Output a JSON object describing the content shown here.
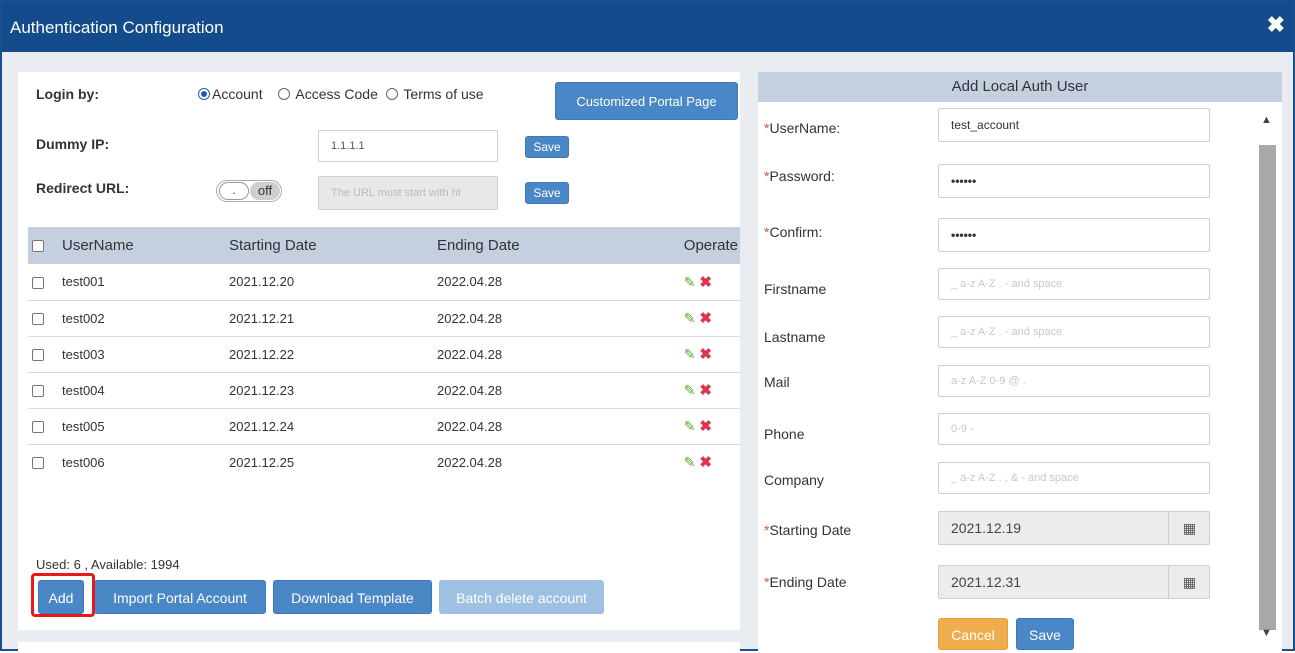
{
  "dialog": {
    "title": "Authentication Configuration",
    "close_glyph": "✖"
  },
  "left": {
    "login_by_label": "Login by:",
    "login_options": [
      {
        "label": "Account",
        "selected": true
      },
      {
        "label": "Access Code",
        "selected": false
      },
      {
        "label": "Terms of use",
        "selected": false
      }
    ],
    "customized_portal_btn": "Customized Portal Page",
    "dummy_ip_label": "Dummy IP:",
    "dummy_ip_value": "1.1.1.1",
    "save_label": "Save",
    "redirect_url_label": "Redirect URL:",
    "redirect_toggle_knob": ".",
    "redirect_toggle_state": "off",
    "redirect_url_placeholder": "The URL must start with ht",
    "table": {
      "headers": [
        "UserName",
        "Starting Date",
        "Ending Date",
        "Operate"
      ],
      "rows": [
        {
          "username": "test001",
          "start": "2021.12.20",
          "end": "2022.04.28"
        },
        {
          "username": "test002",
          "start": "2021.12.21",
          "end": "2022.04.28"
        },
        {
          "username": "test003",
          "start": "2021.12.22",
          "end": "2022.04.28"
        },
        {
          "username": "test004",
          "start": "2021.12.23",
          "end": "2022.04.28"
        },
        {
          "username": "test005",
          "start": "2021.12.24",
          "end": "2022.04.28"
        },
        {
          "username": "test006",
          "start": "2021.12.25",
          "end": "2022.04.28"
        }
      ]
    },
    "usage_text": "Used: 6 , Available: 1994",
    "buttons": {
      "add": "Add",
      "import": "Import Portal Account",
      "download": "Download Template",
      "batch_delete": "Batch delete account"
    }
  },
  "right": {
    "header": "Add Local Auth User",
    "fields": {
      "username": {
        "label": "UserName:",
        "required": true,
        "value": "test_account"
      },
      "password": {
        "label": "Password:",
        "required": true,
        "value": "••••••"
      },
      "confirm": {
        "label": "Confirm:",
        "required": true,
        "value": "••••••"
      },
      "firstname": {
        "label": "Firstname",
        "placeholder": "_ a-z A-Z . - and space"
      },
      "lastname": {
        "label": "Lastname",
        "placeholder": "_ a-z A-Z . - and space"
      },
      "mail": {
        "label": "Mail",
        "placeholder": "a-z A-Z 0-9 @ ."
      },
      "phone": {
        "label": "Phone",
        "placeholder": "0-9 -"
      },
      "company": {
        "label": "Company",
        "placeholder": "_ a-z A-Z . , & - and space"
      },
      "starting_date": {
        "label": "Starting Date",
        "required": true,
        "value": "2021.12.19"
      },
      "ending_date": {
        "label": "Ending Date",
        "required": true,
        "value": "2021.12.31"
      }
    },
    "required_mark": "*",
    "calendar_glyph": "▦",
    "cancel_label": "Cancel",
    "save_label": "Save",
    "scroll_up_glyph": "▲",
    "scroll_down_glyph": "▼"
  },
  "icons": {
    "edit": "✎",
    "delete": "✖"
  },
  "colors": {
    "title_bar": "#144b8c",
    "button": "#4a87c6",
    "table_header": "#c4cfe0",
    "cancel": "#f0ad4e",
    "highlight": "#e41b1b"
  }
}
